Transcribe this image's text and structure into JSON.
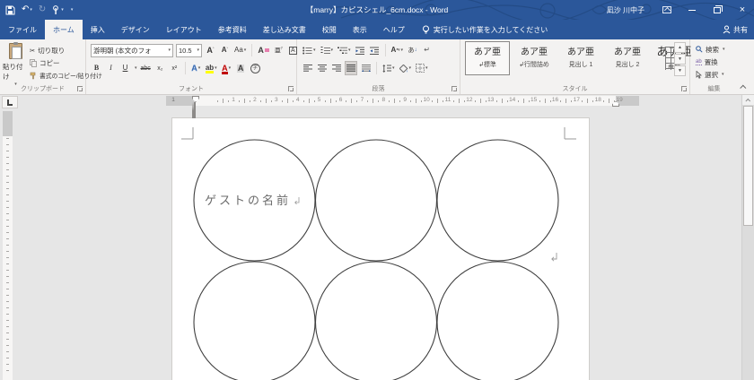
{
  "title_bar": {
    "title": "【marry】カピスシェル_6cm.docx - Word",
    "user_name": "凪沙 川中子"
  },
  "tabs": [
    {
      "id": "file",
      "label": "ファイル"
    },
    {
      "id": "home",
      "label": "ホーム",
      "active": true
    },
    {
      "id": "insert",
      "label": "挿入"
    },
    {
      "id": "design",
      "label": "デザイン"
    },
    {
      "id": "layout",
      "label": "レイアウト"
    },
    {
      "id": "references",
      "label": "参考資料"
    },
    {
      "id": "mailings",
      "label": "差し込み文書"
    },
    {
      "id": "review",
      "label": "校閲"
    },
    {
      "id": "view",
      "label": "表示"
    },
    {
      "id": "help",
      "label": "ヘルプ"
    }
  ],
  "tell_me": "実行したい作業を入力してください",
  "share_label": "共有",
  "ribbon": {
    "clipboard": {
      "label": "クリップボード",
      "paste": "貼り付け",
      "cut": "切り取り",
      "copy": "コピー",
      "format_painter": "書式のコピー/貼り付け"
    },
    "font": {
      "label": "フォント",
      "font_name": "游明朝 (本文のフォ",
      "font_size": "10.5",
      "bold": "B",
      "italic": "I",
      "underline": "U",
      "strike": "abc",
      "subscript": "x₂",
      "superscript": "x²",
      "change_case": "Aa",
      "highlight_color": "#ffff00",
      "font_color": "#c00000"
    },
    "paragraph": {
      "label": "段落"
    },
    "styles": {
      "label": "スタイル",
      "items": [
        {
          "preview": "あア亜",
          "prefix": "↲",
          "name": "標準",
          "selected": true
        },
        {
          "preview": "あア亜",
          "prefix": "↲",
          "name": "行間詰め"
        },
        {
          "preview": "あア亜",
          "prefix": "",
          "name": "見出し 1"
        },
        {
          "preview": "あア亜",
          "prefix": "",
          "name": "見出し 2"
        },
        {
          "preview": "あア亜",
          "prefix": "",
          "name": "表題",
          "title_style": true
        }
      ]
    },
    "editing": {
      "label": "編集",
      "find": "検索",
      "replace": "置換",
      "select": "選択"
    }
  },
  "ruler": {
    "numbers": [
      1,
      2,
      3,
      4,
      5,
      6,
      7,
      8,
      9,
      10,
      11,
      12,
      13,
      14,
      15,
      16,
      17,
      18,
      19
    ],
    "margin_number": "1"
  },
  "document": {
    "page": {
      "guest_label": "ゲストの名前"
    },
    "shapes": {
      "type": "circle-grid",
      "rows": 2,
      "cols": 3,
      "radius": 67.5,
      "centers_x": [
        91.5,
        227,
        362.5
      ],
      "centers_y": [
        91.5,
        227.5
      ],
      "stroke": "#3f3f3f"
    }
  }
}
